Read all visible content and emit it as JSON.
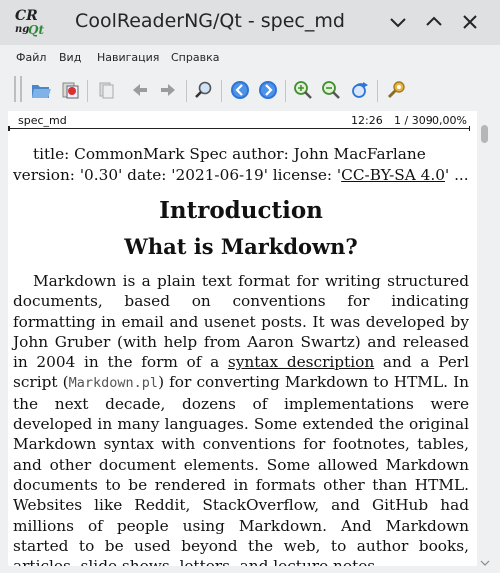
{
  "window": {
    "title": "CoolReaderNG/Qt - spec_md",
    "logo": {
      "line1": "CR",
      "line2a": "ng",
      "line2b": "Qt"
    }
  },
  "menu": [
    "Файл",
    "Вид",
    "Навигация",
    "Справка"
  ],
  "toolbar": {
    "icons": [
      "open-folder-icon",
      "recent-books-icon",
      "copy-icon",
      "back-arrow-icon",
      "forward-arrow-icon",
      "find-icon",
      "prev-page-icon",
      "next-page-icon",
      "zoom-in-icon",
      "zoom-out-icon",
      "rotate-icon",
      "settings-icon"
    ]
  },
  "status": {
    "filename": "spec_md",
    "time": "12:26",
    "pages": "1 / 309",
    "percent": "0,00%"
  },
  "document": {
    "meta_before": "title: CommonMark Spec author: John MacFarlane version: '0.30' date: '2021-06-19' license: '",
    "meta_link": "CC-BY-SA 4.0",
    "meta_after": "' ...",
    "heading1": "Introduction",
    "heading2": "What is Markdown?",
    "para_part1": "Markdown is a plain text format for writing structured documents, based on conventions for indicating formatting in email and usenet posts. It was developed by John Gruber (with help from Aaron Swartz) and released in 2004 in the form of a ",
    "para_link": "syntax description",
    "para_part2": " and a Perl script (",
    "para_code": "Markdown.pl",
    "para_part3": ") for converting Markdown to HTML. In the next decade, dozens of implementations were developed in many languages. Some extended the original Markdown syntax with conventions for footnotes, tables, and other document elements. Some allowed Markdown documents to be rendered in formats other than HTML. Websites like Reddit, StackOverflow, and GitHub had millions of people using Markdown. And Markdown started to be used beyond the web, to author books, articles, slide shows, letters, and lecture notes."
  }
}
